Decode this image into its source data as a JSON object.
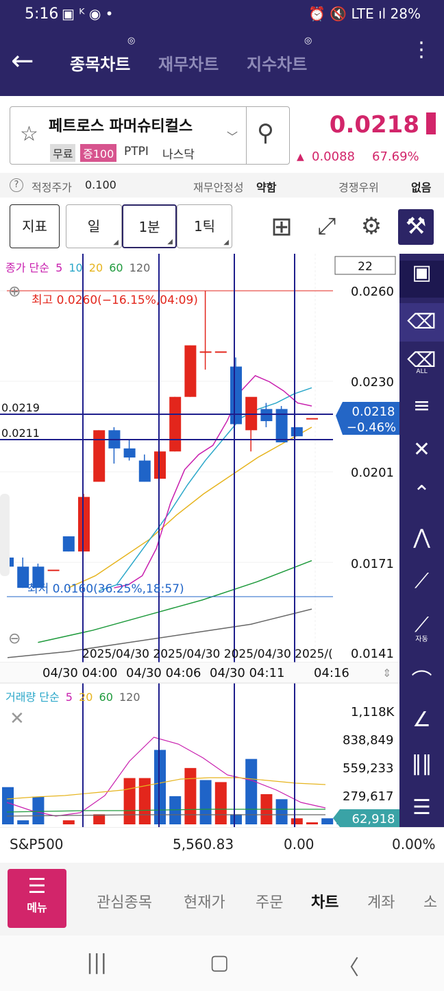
{
  "status_bar": {
    "time": "5:16",
    "left_icons": "▣ ᴷ ◉ •",
    "right_icons": "⏰ 🔇 LTE ıl",
    "battery": "28%"
  },
  "app_bar": {
    "back_icon": "arrow-left-icon",
    "tabs": [
      {
        "label": "종목차트",
        "active": true
      },
      {
        "label": "재무차트",
        "active": false
      },
      {
        "label": "지수차트",
        "active": false
      }
    ],
    "tab_marker": "◎",
    "more_icon": "⋮"
  },
  "stock": {
    "name": "페트로스 파머슈티컬스",
    "badge_free": "무료",
    "badge_margin": "증100",
    "ticker": "PTPI",
    "market": "나스닥",
    "price": "0.0218",
    "change_arrow": "▲",
    "change": "0.0088",
    "change_pct": "67.69%"
  },
  "info_row": {
    "help": "?",
    "fair_label": "적정주가",
    "fair_value": "0.100",
    "fin_label": "재무안정성",
    "fin_value": "약함",
    "comp_label": "경쟁우위",
    "comp_value": "없음"
  },
  "toolbar": {
    "indicator": "지표",
    "day": "일",
    "minute": "1분",
    "tick": "1틱",
    "corner": "◢"
  },
  "chart": {
    "count_box": "22",
    "ma_legend": {
      "prefix": "종가 단순",
      "p5": "5",
      "p10": "10",
      "p20": "20",
      "p60": "60",
      "p120": "120"
    },
    "max_label": "최고 0.0260(−16.15%,04:09)",
    "min_label": "최저 0.0160(36.25%,18:57)",
    "hline_labels": [
      "0.0219",
      "0.0211"
    ],
    "price_axis": [
      "0.0260",
      "0.0230",
      "0.0201",
      "0.0171",
      "0.0141"
    ],
    "current_price": "0.0218",
    "current_pct": "−0.46%",
    "date_overlap": "2025/04/30  2025/04/30  2025/04/30  2025/(",
    "time_axis": [
      "04/30 04:00",
      "04/30 04:06",
      "04/30 04:11",
      "04:16"
    ],
    "vol_legend": {
      "prefix": "거래량 단순",
      "p5": "5",
      "p20": "20",
      "p60": "60",
      "p120": "120"
    },
    "vol_axis": [
      "1,118K",
      "838,849",
      "559,233",
      "279,617"
    ],
    "vol_current": "62,918",
    "colors": {
      "up": "#e3261c",
      "down": "#1f64c8",
      "ma5": "#c81eae",
      "ma10": "#2aa7c9",
      "ma20": "#e6b41e",
      "ma60": "#1e9a3c",
      "ma120": "#666666",
      "nav": "#2c2566",
      "accent": "#d2256a"
    }
  },
  "chart_data": {
    "type": "candlestick",
    "ylim": [
      0.0141,
      0.026
    ],
    "candles": [
      {
        "o": 0.0172,
        "h": 0.0176,
        "l": 0.0168,
        "c": 0.0169
      },
      {
        "o": 0.0169,
        "h": 0.0172,
        "l": 0.0162,
        "c": 0.0162
      },
      {
        "o": 0.0169,
        "h": 0.017,
        "l": 0.0162,
        "c": 0.0162
      },
      {
        "o": 0.0168,
        "h": 0.0168,
        "l": 0.0168,
        "c": 0.0168
      },
      {
        "o": 0.0179,
        "h": 0.0179,
        "l": 0.0174,
        "c": 0.0174
      },
      {
        "o": 0.0174,
        "h": 0.0193,
        "l": 0.0174,
        "c": 0.0192
      },
      {
        "o": 0.0197,
        "h": 0.0214,
        "l": 0.0197,
        "c": 0.0214
      },
      {
        "o": 0.0214,
        "h": 0.0215,
        "l": 0.0203,
        "c": 0.0208
      },
      {
        "o": 0.0208,
        "h": 0.0211,
        "l": 0.0204,
        "c": 0.0205
      },
      {
        "o": 0.0204,
        "h": 0.0206,
        "l": 0.0197,
        "c": 0.0197
      },
      {
        "o": 0.0198,
        "h": 0.0207,
        "l": 0.0198,
        "c": 0.0207
      },
      {
        "o": 0.0207,
        "h": 0.0225,
        "l": 0.0207,
        "c": 0.0225
      },
      {
        "o": 0.0225,
        "h": 0.0242,
        "l": 0.0225,
        "c": 0.0242
      },
      {
        "o": 0.024,
        "h": 0.026,
        "l": 0.0234,
        "c": 0.024
      },
      {
        "o": 0.024,
        "h": 0.024,
        "l": 0.024,
        "c": 0.024
      },
      {
        "o": 0.0235,
        "h": 0.0238,
        "l": 0.0216,
        "c": 0.0216
      },
      {
        "o": 0.0214,
        "h": 0.0222,
        "l": 0.0207,
        "c": 0.0225
      },
      {
        "o": 0.0221,
        "h": 0.0223,
        "l": 0.0215,
        "c": 0.0217
      },
      {
        "o": 0.0221,
        "h": 0.0222,
        "l": 0.021,
        "c": 0.021
      },
      {
        "o": 0.0215,
        "h": 0.0215,
        "l": 0.0212,
        "c": 0.0212
      },
      {
        "o": 0.0218,
        "h": 0.0218,
        "l": 0.0218,
        "c": 0.0218
      }
    ],
    "volumes": [
      370000,
      40000,
      275000,
      0,
      40000,
      0,
      100000,
      0,
      460000,
      460000,
      740000,
      280000,
      560000,
      440000,
      420000,
      100000,
      650000,
      300000,
      250000,
      60000,
      20000,
      60000,
      62918
    ],
    "ma5": [
      0.0162,
      0.0163,
      0.0166,
      0.0175,
      0.019,
      0.0201,
      0.0206,
      0.0209,
      0.0217,
      0.0227,
      0.0232,
      0.023,
      0.0227,
      0.0223,
      0.0222
    ],
    "ma10": [
      0.0161,
      0.0163,
      0.0171,
      0.0179,
      0.0187,
      0.0196,
      0.0204,
      0.0211,
      0.0218,
      0.0221,
      0.0223,
      0.0226,
      0.0228
    ],
    "ma20": [
      0.0162,
      0.0166,
      0.0172,
      0.0178,
      0.0186,
      0.0193,
      0.0199,
      0.0205,
      0.021,
      0.0215
    ],
    "ma60": [
      0.0144,
      0.0148,
      0.0153,
      0.0158,
      0.0164,
      0.0171
    ],
    "ma120": [
      0.0139,
      0.0141,
      0.0144,
      0.0147,
      0.015,
      0.0155
    ]
  },
  "sidebar": [
    "save-icon",
    "eraser-icon",
    "eraser-all-icon",
    "hcl-line-icon",
    "cross-line-icon",
    "horizontal-line-icon",
    "vertical-line-icon",
    "trend-line-icon",
    "auto-trend-icon",
    "fan-icon",
    "angle-line-icon",
    "parallel-lines-icon",
    "horizontal-channel-icon"
  ],
  "sidebar_labels": {
    "all": "ALL",
    "auto": "자동"
  },
  "bottom_ticker": {
    "name": "S&P500",
    "value": "5,560.83",
    "change": "0.00",
    "pct": "0.00%"
  },
  "menu": {
    "button_label": "메뉴",
    "items": [
      {
        "label": "관심종목",
        "active": false
      },
      {
        "label": "현재가",
        "active": false
      },
      {
        "label": "주문",
        "active": false
      },
      {
        "label": "차트",
        "active": true
      },
      {
        "label": "계좌",
        "active": false
      },
      {
        "label": "소",
        "active": false
      }
    ]
  }
}
